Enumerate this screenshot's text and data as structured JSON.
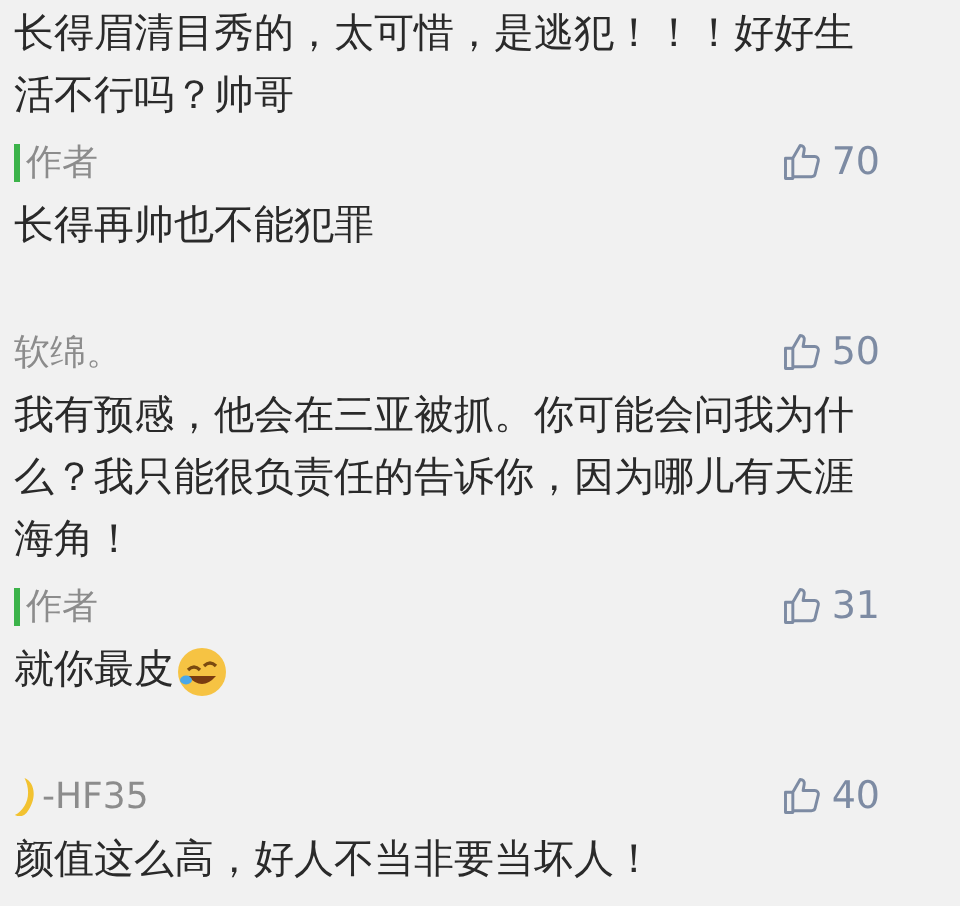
{
  "comments": [
    {
      "kind": "comment",
      "text": "长得眉清目秀的，太可惜，是逃犯！！！好好生活不行吗？帅哥"
    },
    {
      "kind": "author_reply",
      "name": "作者",
      "likes": "70",
      "text": "长得再帅也不能犯罪"
    },
    {
      "kind": "comment",
      "name": "软绵。",
      "likes": "50",
      "text": "我有预感，他会在三亚被抓。你可能会问我为什么？我只能很负责任的告诉你，因为哪儿有天涯海角！"
    },
    {
      "kind": "author_reply",
      "name": "作者",
      "likes": "31",
      "text": "就你最皮",
      "laughing_emoji": true
    },
    {
      "kind": "comment",
      "moon_icon": true,
      "name": "-HF35",
      "likes": "40",
      "text": "颜值这么高，好人不当非要当坏人！"
    }
  ]
}
